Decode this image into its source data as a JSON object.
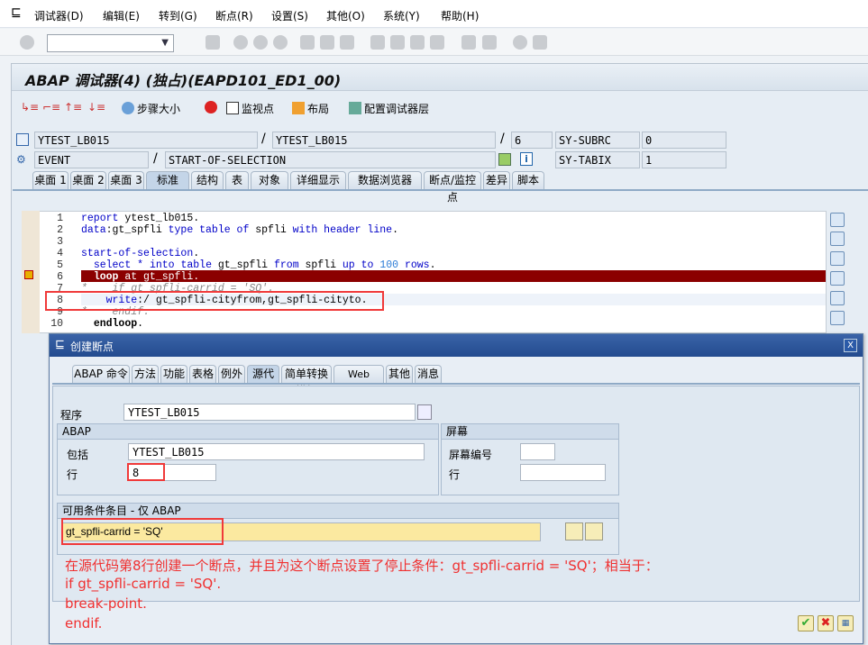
{
  "menu": [
    "调试器(D)",
    "编辑(E)",
    "转到(G)",
    "断点(R)",
    "设置(S)",
    "其他(O)",
    "系统(Y)",
    "帮助(H)"
  ],
  "command_field": {
    "value": ""
  },
  "window_title": "ABAP 调试器(4)  (独占)(EAPD101_ED1_00)",
  "app_toolbar": {
    "step_size": "步骤大小",
    "watchpoint": "监视点",
    "layout": "布局",
    "config_layers": "配置调试器层"
  },
  "status": {
    "program": "YTEST_LB015",
    "include": "YTEST_LB015",
    "line": "6",
    "sy_subrc_label": "SY-SUBRC",
    "sy_subrc": "0",
    "event_type": "EVENT",
    "event": "START-OF-SELECTION",
    "sy_tabix_label": "SY-TABIX",
    "sy_tabix": "1",
    "sep": "/"
  },
  "tabs": [
    "桌面 1",
    "桌面 2",
    "桌面 3",
    "标准",
    "结构",
    "表",
    "对象",
    "详细显示",
    "数据浏览器",
    "断点/监控点",
    "差异",
    "脚本"
  ],
  "active_tab": "标准",
  "code": [
    {
      "n": "1",
      "html": "<span class='kw'>report</span> ytest_lb015."
    },
    {
      "n": "2",
      "html": "<span class='kw'>data</span>:gt_spfli <span class='kw'>type table of</span> spfli <span class='kw'>with header line</span>."
    },
    {
      "n": "3",
      "html": ""
    },
    {
      "n": "4",
      "html": "<span class='kw'>start-of-selection</span>."
    },
    {
      "n": "5",
      "html": "  <span class='kw'>select</span> <span class='kw'>*</span> <span class='kw'>into table</span> gt_spfli <span class='kw'>from</span> spfli <span class='kw'>up to</span> <span class='num'>100</span> <span class='kw'>rows</span>."
    },
    {
      "n": "6",
      "html": "  <b>loop</b> at gt_spfli."
    },
    {
      "n": "7",
      "html": "<span class='cm'>*    if gt_spfli-carrid = 'SQ'.</span>"
    },
    {
      "n": "8",
      "html": "    <span class='kw'>write</span>:/ gt_spfli-cityfrom,gt_spfli-cityto."
    },
    {
      "n": "9",
      "html": "<span class='cm'>*    endif.</span>"
    },
    {
      "n": "10",
      "html": "  <b>endloop</b>."
    }
  ],
  "current_line": "6",
  "dialog": {
    "title": "创建断点",
    "close": "X",
    "tabs": [
      "ABAP 命令",
      "方法",
      "功能",
      "表格",
      "例外",
      "源代码",
      "简单转换模板",
      "Web Dynpro",
      "其他",
      "消息"
    ],
    "active_tab": "源代码",
    "program_label": "程序",
    "program": "YTEST_LB015",
    "abap_group": "ABAP",
    "include_label": "包括",
    "include": "YTEST_LB015",
    "line_label": "行",
    "line": "8",
    "screen_group": "屏幕",
    "screen_no_label": "屏幕编号",
    "screen_no": "",
    "screen_line_label": "行",
    "screen_line": "",
    "condition_group": "可用条件条目 - 仅 ABAP",
    "condition": "gt_spfli-carrid = 'SQ'"
  },
  "annotation": [
    "在源代码第8行创建一个断点，并且为这个断点设置了停止条件：gt_spfli-carrid = 'SQ'；相当于：",
    "if gt_spfli-carrid = 'SQ'.",
    "break-point.",
    "endif."
  ]
}
